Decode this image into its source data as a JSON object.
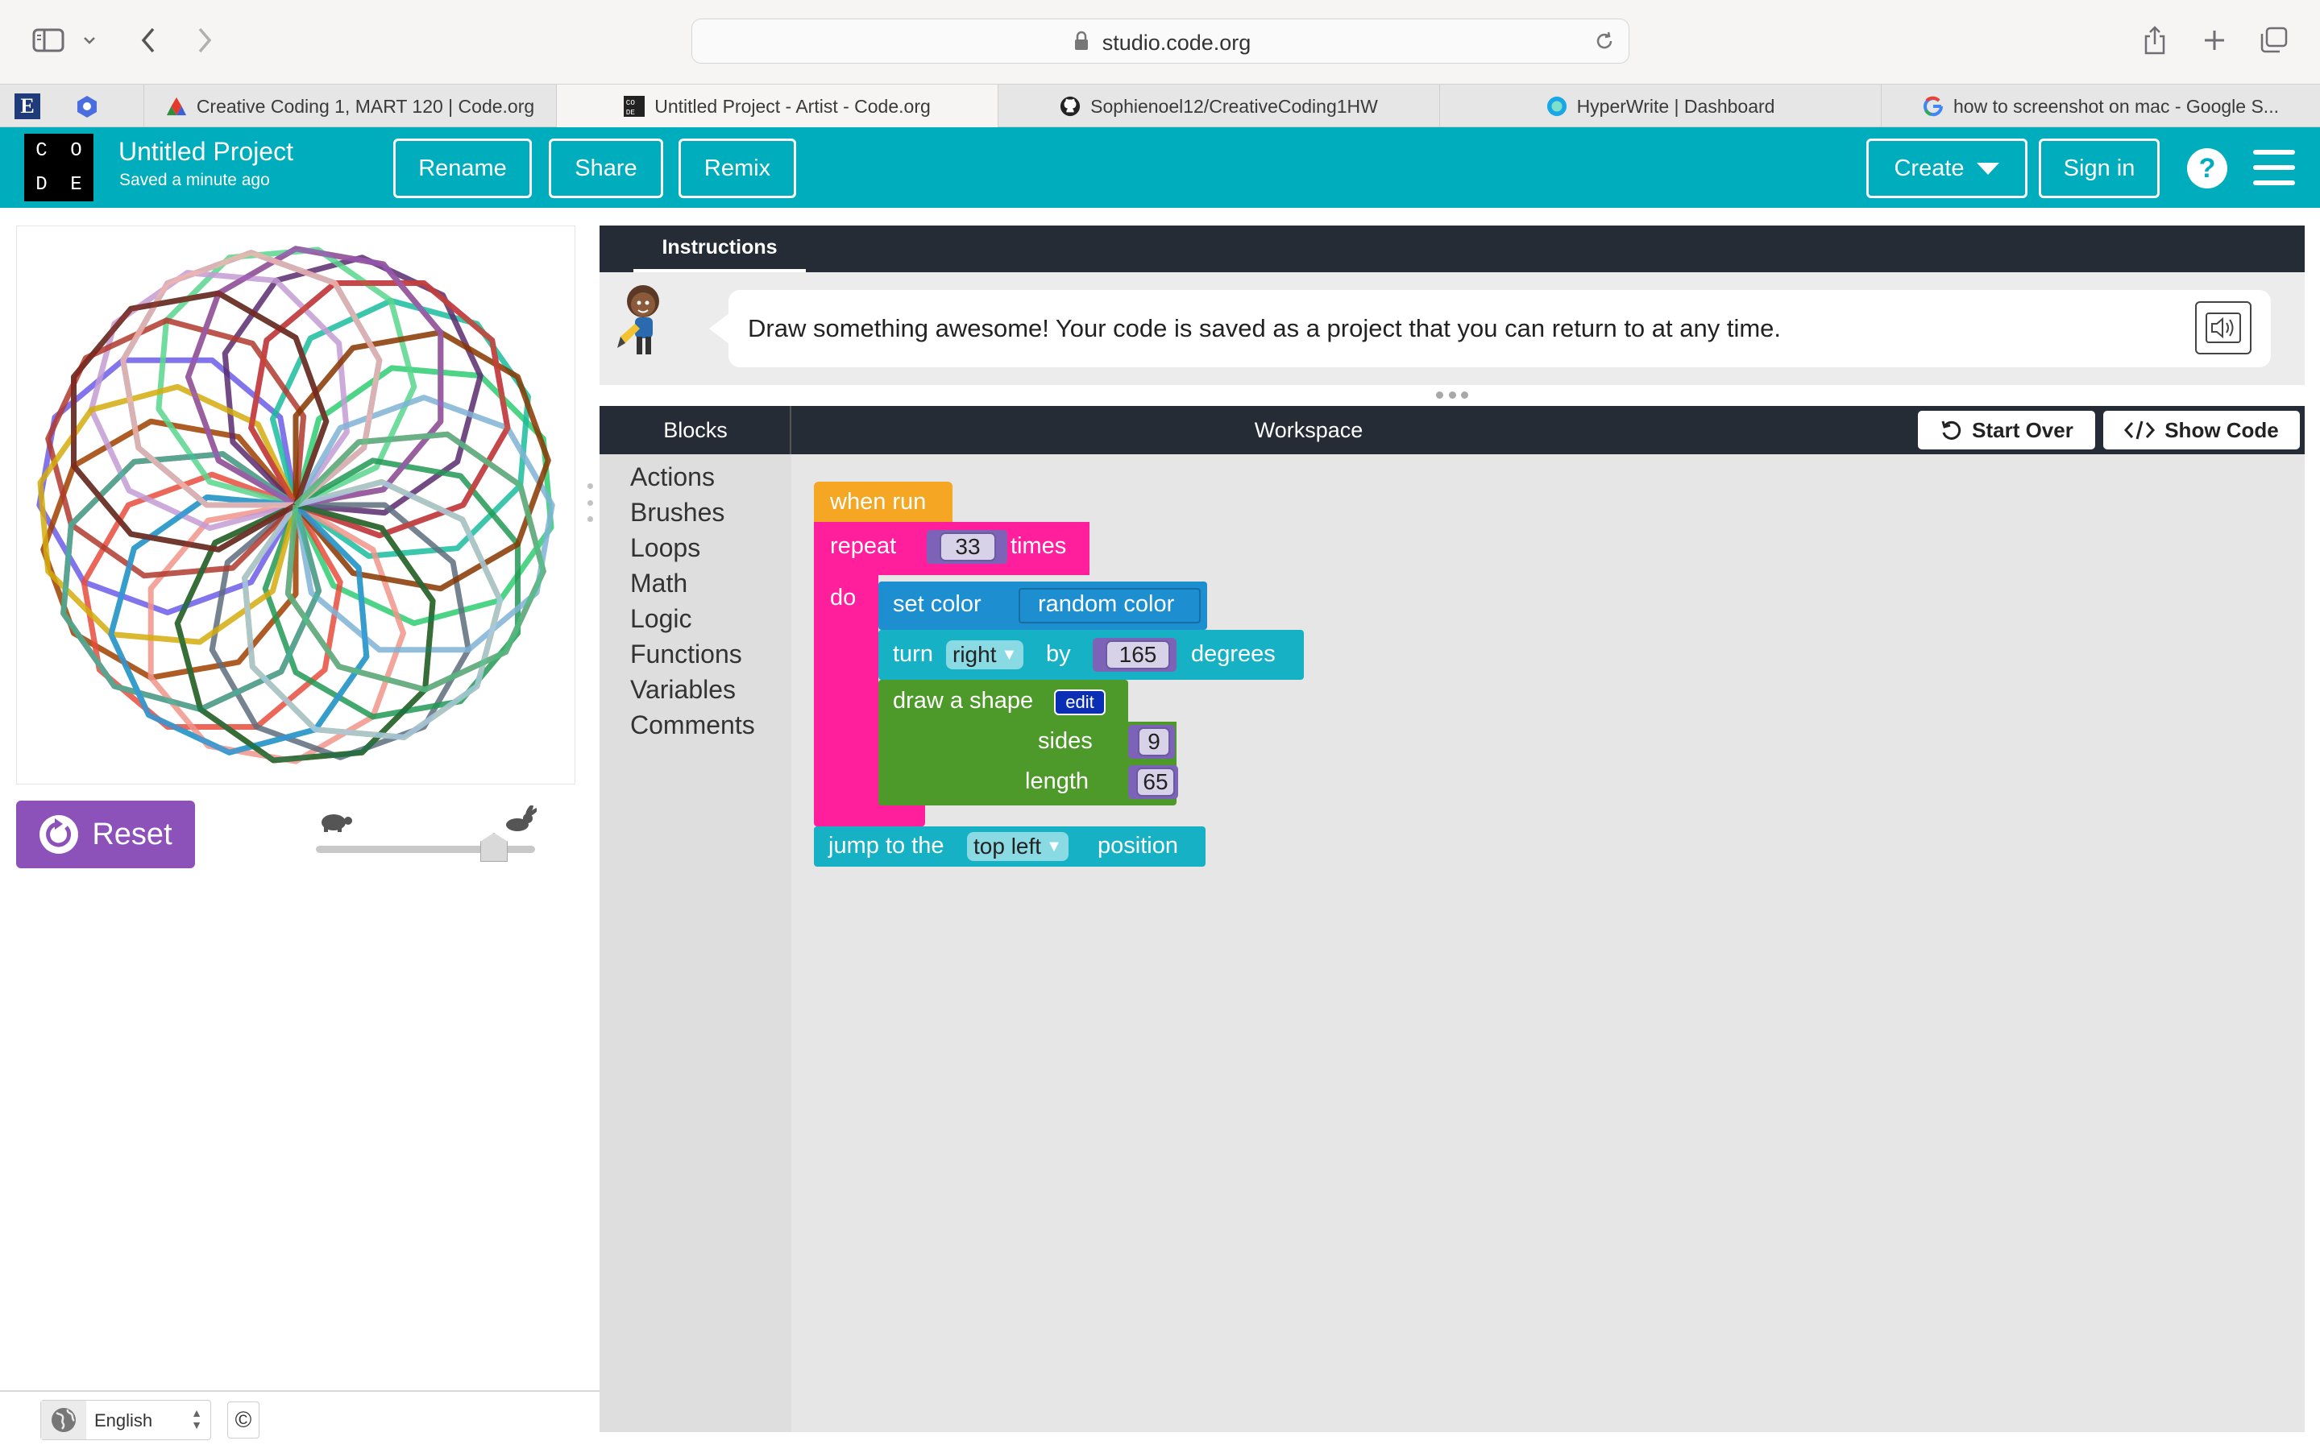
{
  "browser": {
    "url": "studio.code.org",
    "tabs": [
      {
        "label": "Creative Coding 1, MART 120 | Code.org"
      },
      {
        "label": "Untitled Project - Artist - Code.org"
      },
      {
        "label": "Sophienoel12/CreativeCoding1HW"
      },
      {
        "label": "HyperWrite | Dashboard"
      },
      {
        "label": "how to screenshot on mac - Google S..."
      }
    ]
  },
  "header": {
    "logo": [
      "C",
      "O",
      "D",
      "E"
    ],
    "project_title": "Untitled Project",
    "save_status": "Saved a minute ago",
    "rename_label": "Rename",
    "share_label": "Share",
    "remix_label": "Remix",
    "create_label": "Create",
    "signin_label": "Sign in",
    "help_label": "?",
    "brand_color": "#00adbc"
  },
  "left_panel": {
    "reset_label": "Reset",
    "language": "English",
    "copyright_symbol": "©",
    "speed": 0.8
  },
  "instructions": {
    "tab_label": "Instructions",
    "text": "Draw something awesome! Your code is saved as a project that you can return to at any time."
  },
  "workspace": {
    "blocks_label": "Blocks",
    "workspace_label": "Workspace",
    "start_over_label": "Start Over",
    "show_code_label": "Show Code",
    "categories": [
      "Actions",
      "Brushes",
      "Loops",
      "Math",
      "Logic",
      "Functions",
      "Variables",
      "Comments"
    ],
    "program": {
      "when_run": "when run",
      "repeat": "repeat",
      "repeat_count": "33",
      "times": "times",
      "do": "do",
      "set_color": "set color",
      "random_color": "random color",
      "turn": "turn",
      "turn_dir": "right",
      "by": "by",
      "turn_amount": "165",
      "degrees": "degrees",
      "draw_shape": "draw a shape",
      "edit": "edit",
      "sides_label": "sides",
      "sides": "9",
      "length_label": "length",
      "length": "65",
      "jump_to": "jump to the",
      "jump_pos": "top left",
      "position": "position"
    }
  }
}
